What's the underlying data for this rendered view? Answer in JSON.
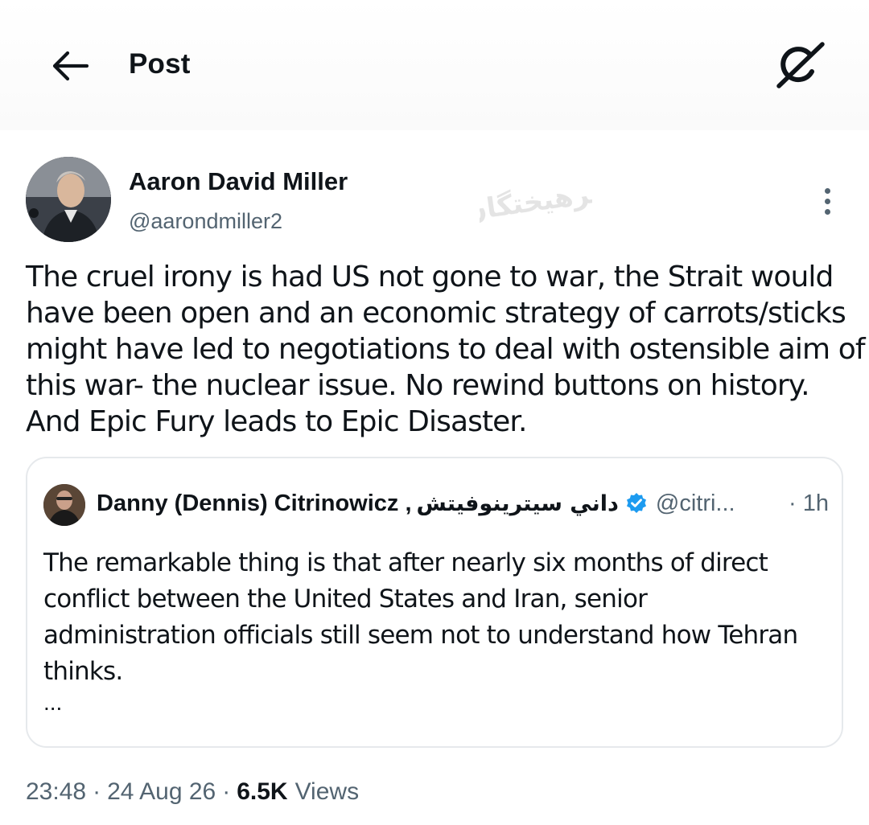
{
  "header": {
    "title": "Post",
    "back_icon": "arrow-left-icon",
    "grok_icon": "grok-icon"
  },
  "tweet": {
    "author_name": "Aaron David Miller",
    "author_handle": "@aarondmiller2",
    "watermark_text": "فرهیختگان",
    "more_icon": "more-vertical-icon",
    "lines": [
      "The cruel irony is had US  not gone to war, the Strait would",
      "have been open and an economic strategy of carrots/sticks",
      "might have led to negotiations to deal with ostensible aim of",
      "this war- the nuclear issue. No rewind buttons on history.",
      "And Epic Fury leads to Epic Disaster."
    ]
  },
  "quote": {
    "author_name": "Danny (Dennis) Citrinowicz ,",
    "author_name_arabic": "داني سيترينوفيتش",
    "verified_icon": "verified-badge-icon",
    "handle": "@citri...",
    "time": "· 1h",
    "lines": [
      "The remarkable thing is that after nearly six months of direct",
      "conflict between the United States and Iran, senior",
      "administration officials still seem not to understand how Tehran",
      "thinks."
    ],
    "ellipsis": "..."
  },
  "meta": {
    "time": "23:48",
    "separator": "·",
    "date": "24 Aug 26",
    "views_count": "6.5K",
    "views_label": "Views"
  },
  "colors": {
    "text_primary": "#0f1419",
    "text_secondary": "#536471",
    "border": "#e6e9ec",
    "verified": "#1d9bf0"
  }
}
